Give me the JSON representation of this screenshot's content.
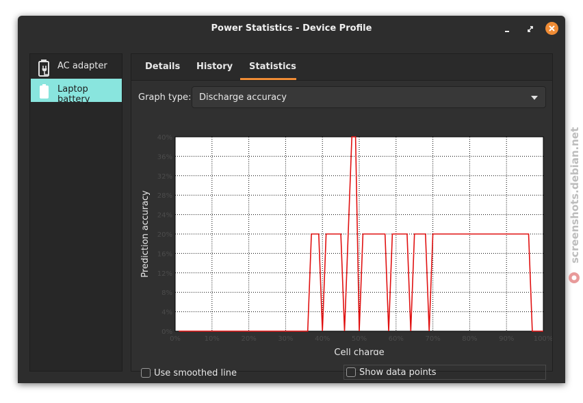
{
  "window": {
    "title": "Power Statistics - Device Profile"
  },
  "sidebar": {
    "items": [
      {
        "label": "AC adapter",
        "icon": "ac-adapter-icon",
        "selected": false
      },
      {
        "label": "Laptop battery",
        "icon": "battery-icon",
        "selected": true
      }
    ]
  },
  "tabs": [
    {
      "label": "Details",
      "active": false
    },
    {
      "label": "History",
      "active": false
    },
    {
      "label": "Statistics",
      "active": true
    }
  ],
  "graph_type": {
    "label": "Graph type:",
    "value": "Discharge accuracy"
  },
  "options": {
    "smoothed_line": {
      "label": "Use smoothed line",
      "checked": false
    },
    "data_points": {
      "label": "Show data points",
      "checked": false
    }
  },
  "watermark": "screenshots.debian.net",
  "colors": {
    "accent": "#f08c35",
    "selected_row": "#89e5de",
    "line": "#e01010"
  },
  "chart_data": {
    "type": "line",
    "xlabel": "Cell charge",
    "ylabel": "Prediction accuracy",
    "xlim": [
      0,
      100
    ],
    "ylim": [
      0,
      40
    ],
    "grid": true,
    "x_ticks": [
      "0%",
      "10%",
      "20%",
      "30%",
      "40%",
      "50%",
      "60%",
      "70%",
      "80%",
      "90%",
      "100%"
    ],
    "y_ticks": [
      "0%",
      "4%",
      "8%",
      "12%",
      "16%",
      "20%",
      "24%",
      "28%",
      "32%",
      "36%",
      "40%"
    ],
    "series": [
      {
        "x": [
          1,
          36,
          37,
          39,
          40,
          41,
          45,
          46,
          48,
          49,
          50,
          51,
          57,
          58,
          59,
          63,
          64,
          65,
          68,
          69,
          70,
          96,
          97,
          100
        ],
        "y": [
          0,
          0,
          20,
          20,
          0,
          20,
          20,
          0,
          40,
          40,
          0,
          20,
          20,
          0,
          20,
          20,
          0,
          20,
          20,
          0,
          20,
          20,
          0,
          0
        ]
      }
    ]
  }
}
